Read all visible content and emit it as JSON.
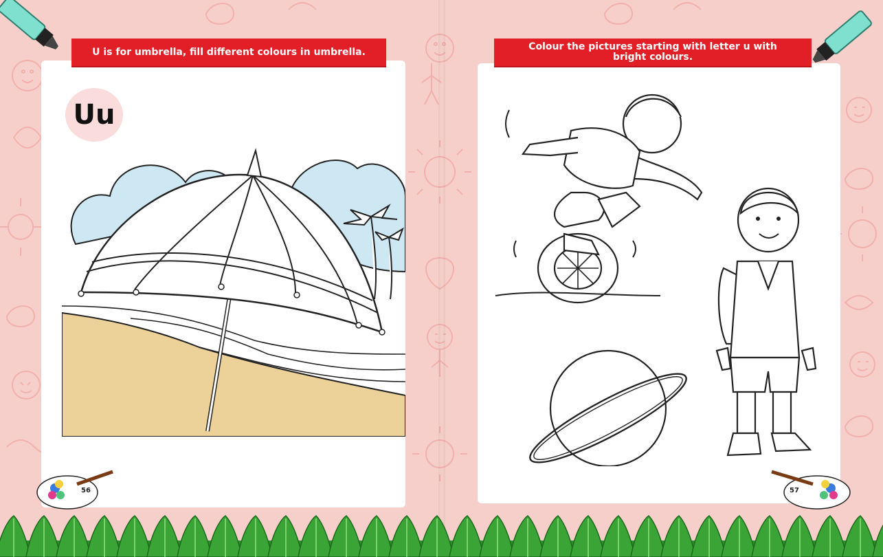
{
  "left_page": {
    "instruction": "U is for umbrella, fill different colours in umbrella.",
    "letter": "Uu",
    "page_number": "56"
  },
  "right_page": {
    "instruction": "Colour the pictures starting with letter u with bright colours.",
    "page_number": "57"
  },
  "colors": {
    "page_background": "#f6cfca",
    "banner_red": "#e21f26",
    "sky_blue": "#cde8f3",
    "sand": "#ecd199",
    "grass_green": "#3aa536",
    "marker_teal": "#7fe0cf"
  },
  "icons": [
    "marker-icon",
    "paint-palette-icon",
    "grass-border"
  ]
}
